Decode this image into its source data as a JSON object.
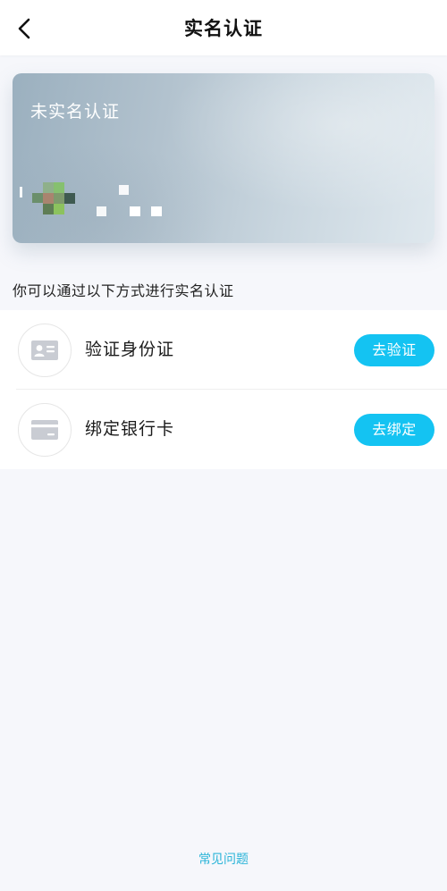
{
  "header": {
    "title": "实名认证",
    "back_icon": "chevron-left-icon"
  },
  "card": {
    "status_text": "未实名认证",
    "masked": true
  },
  "prompt": "你可以通过以下方式进行实名认证",
  "options": [
    {
      "icon": "id-card-icon",
      "label": "验证身份证",
      "button_label": "去验证"
    },
    {
      "icon": "bank-card-icon",
      "label": "绑定银行卡",
      "button_label": "去绑定"
    }
  ],
  "footer": {
    "faq_label": "常见问题"
  },
  "colors": {
    "accent": "#14c3f2",
    "link": "#2ab4d8",
    "background": "#f6f7fb"
  }
}
